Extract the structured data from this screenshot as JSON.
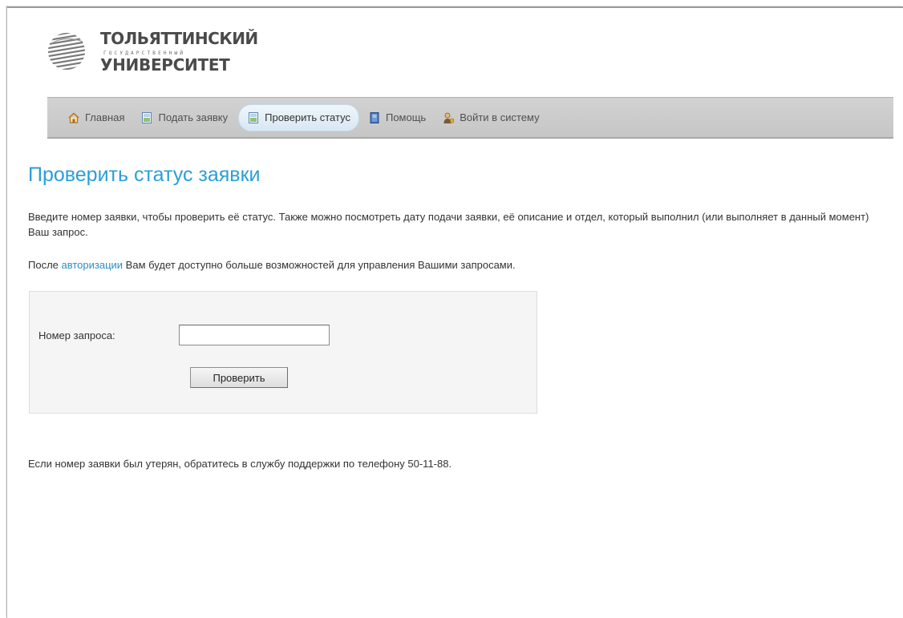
{
  "logo": {
    "line1": "ТОЛЬЯТТИНСКИЙ",
    "line2": "ГОСУДАРСТВЕННЫЙ",
    "line3": "УНИВЕРСИТЕТ",
    "icon": "globe-emblem-icon"
  },
  "nav": {
    "items": [
      {
        "label": "Главная",
        "icon": "home-icon",
        "active": false
      },
      {
        "label": "Подать заявку",
        "icon": "submit-document-icon",
        "active": false
      },
      {
        "label": "Проверить статус",
        "icon": "check-document-icon",
        "active": true
      },
      {
        "label": "Помощь",
        "icon": "help-book-icon",
        "active": false
      },
      {
        "label": "Войти в систему",
        "icon": "login-user-icon",
        "active": false
      }
    ]
  },
  "page": {
    "title": "Проверить статус заявки",
    "intro": "Введите номер заявки, чтобы проверить её статус. Также можно посмотреть дату подачи заявки, её описание и отдел, который выполнил (или выполняет в данный момент) Ваш запрос.",
    "auth_before": "После ",
    "auth_link": "авторизации",
    "auth_after": " Вам будет доступно больше возможностей для управления Вашими запросами.",
    "lost_note": "Если номер заявки был утерян, обратитесь в службу поддержки по телефону 50-11-88."
  },
  "form": {
    "label": "Номер запроса:",
    "input_value": "",
    "button_label": "Проверить"
  },
  "colors": {
    "title": "#2a9fd6",
    "link": "#2a8fc6",
    "nav_bg": "#cccccc",
    "form_bg": "#f5f5f5"
  }
}
